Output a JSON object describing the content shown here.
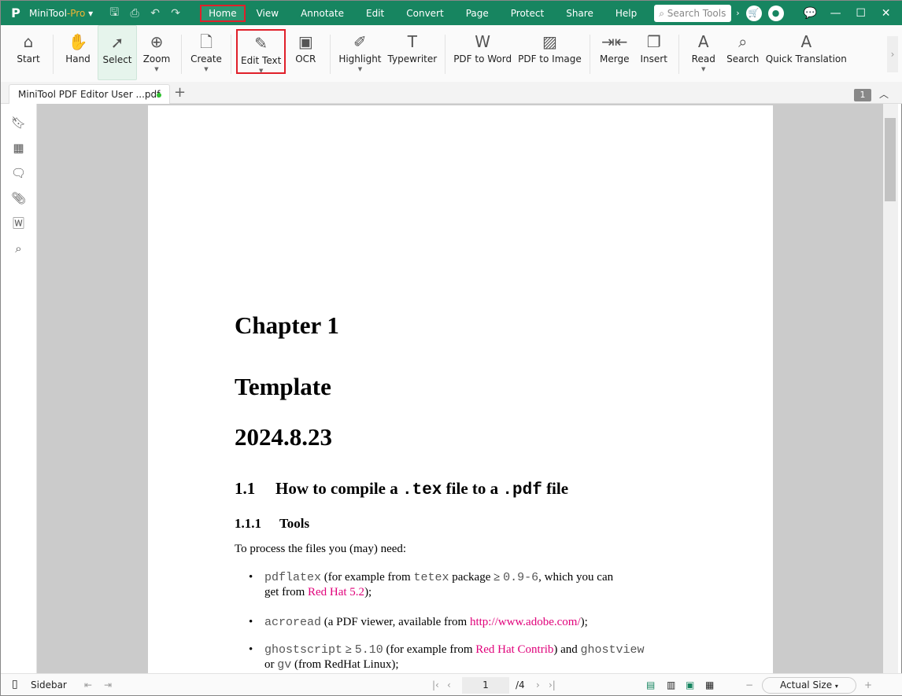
{
  "app": {
    "name": "MiniTool",
    "edition": "-Pro",
    "logo_text": "P"
  },
  "menu": [
    "Home",
    "View",
    "Annotate",
    "Edit",
    "Convert",
    "Page",
    "Protect",
    "Share",
    "Help"
  ],
  "search_placeholder": "Search Tools",
  "toolbar": [
    {
      "label": "Start",
      "icon": "home-icon",
      "glyph": "⌂"
    },
    {
      "label": "Hand",
      "icon": "hand-icon",
      "glyph": "✋"
    },
    {
      "label": "Select",
      "icon": "cursor-icon",
      "glyph": "➚"
    },
    {
      "label": "Zoom",
      "icon": "zoom-in-icon",
      "glyph": "⊕"
    },
    {
      "label": "Create",
      "icon": "create-file-icon",
      "glyph": "🗋"
    },
    {
      "label": "Edit Text",
      "icon": "edit-text-icon",
      "glyph": "✎"
    },
    {
      "label": "OCR",
      "icon": "ocr-icon",
      "glyph": "▣"
    },
    {
      "label": "Highlight",
      "icon": "highlighter-icon",
      "glyph": "✐"
    },
    {
      "label": "Typewriter",
      "icon": "typewriter-icon",
      "glyph": "T"
    },
    {
      "label": "PDF to Word",
      "icon": "pdf-to-word-icon",
      "glyph": "W"
    },
    {
      "label": "PDF to Image",
      "icon": "pdf-to-image-icon",
      "glyph": "▨"
    },
    {
      "label": "Merge",
      "icon": "merge-icon",
      "glyph": "⇥⇤"
    },
    {
      "label": "Insert",
      "icon": "insert-page-icon",
      "glyph": "❐"
    },
    {
      "label": "Read",
      "icon": "read-aloud-icon",
      "glyph": "A"
    },
    {
      "label": "Search",
      "icon": "search-doc-icon",
      "glyph": "⌕"
    },
    {
      "label": "Quick Translation",
      "icon": "translate-icon",
      "glyph": "A"
    }
  ],
  "tab": {
    "title": "MiniTool PDF Editor User ...pdf",
    "page_badge": "1"
  },
  "doc": {
    "chapter": "Chapter 1",
    "title": "Template",
    "date": "2024.8.23",
    "section_num": "1.1",
    "section_a": "How to compile a ",
    "section_tex": ".tex",
    "section_b": " file to a ",
    "section_pdf": ".pdf",
    "section_c": " file",
    "subsection_num": "1.1.1",
    "subsection": "Tools",
    "intro": "To process the files you (may) need:",
    "items": [
      {
        "code": "pdflatex",
        "a": " (for example from ",
        "code2": "tetex",
        "b": " package ≥ ",
        "code3": "0.9-6",
        "c": ", which you can",
        "line2a": "get from ",
        "link": "Red Hat 5.2",
        "line2b": ");"
      },
      {
        "code": "acroread",
        "a": " (a PDF viewer, available from ",
        "link": "http://www.adobe.com/",
        "b": ");"
      },
      {
        "code": "ghostscript",
        "a": " ≥ ",
        "code2": "5.10",
        "b": " (for example from ",
        "link": "Red Hat Contrib",
        "c": ") and ",
        "code3": "ghostview",
        "line2a": "or ",
        "code4": "gv",
        "line2b": " (from RedHat Linux);"
      }
    ]
  },
  "status": {
    "sidebar": "Sidebar",
    "page": "1",
    "total": "/4",
    "zoom": "Actual Size"
  },
  "colors": {
    "brand": "#178560",
    "highlight_box": "#e0202a",
    "link": "#e0007a"
  }
}
